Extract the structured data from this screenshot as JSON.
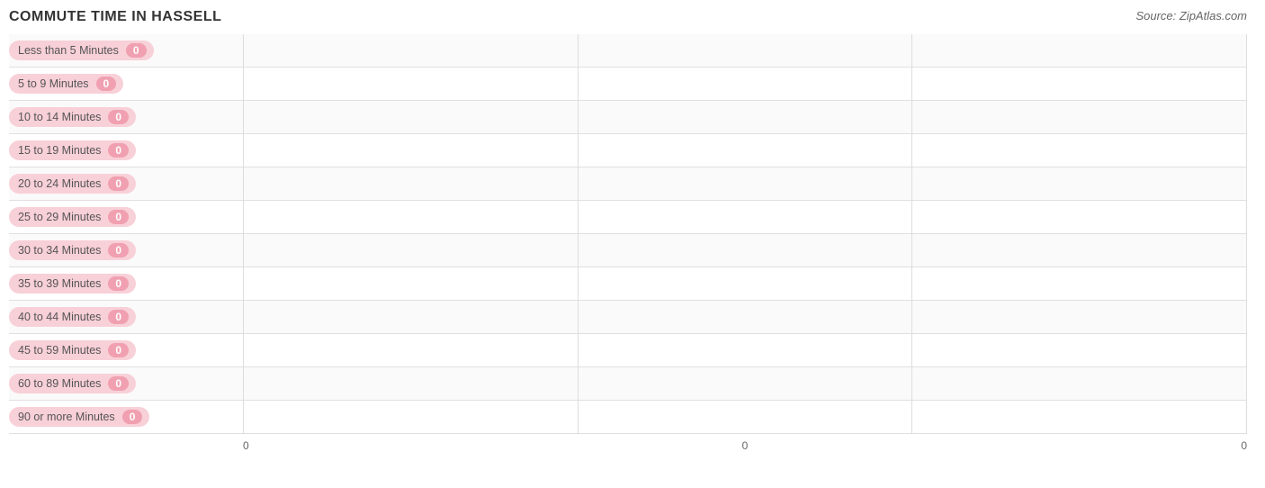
{
  "chart": {
    "title": "COMMUTE TIME IN HASSELL",
    "source": "Source: ZipAtlas.com",
    "bars": [
      {
        "label": "Less than 5 Minutes",
        "value": 0
      },
      {
        "label": "5 to 9 Minutes",
        "value": 0
      },
      {
        "label": "10 to 14 Minutes",
        "value": 0
      },
      {
        "label": "15 to 19 Minutes",
        "value": 0
      },
      {
        "label": "20 to 24 Minutes",
        "value": 0
      },
      {
        "label": "25 to 29 Minutes",
        "value": 0
      },
      {
        "label": "30 to 34 Minutes",
        "value": 0
      },
      {
        "label": "35 to 39 Minutes",
        "value": 0
      },
      {
        "label": "40 to 44 Minutes",
        "value": 0
      },
      {
        "label": "45 to 59 Minutes",
        "value": 0
      },
      {
        "label": "60 to 89 Minutes",
        "value": 0
      },
      {
        "label": "90 or more Minutes",
        "value": 0
      }
    ],
    "xAxisLabels": [
      "0",
      "0",
      "0"
    ]
  }
}
